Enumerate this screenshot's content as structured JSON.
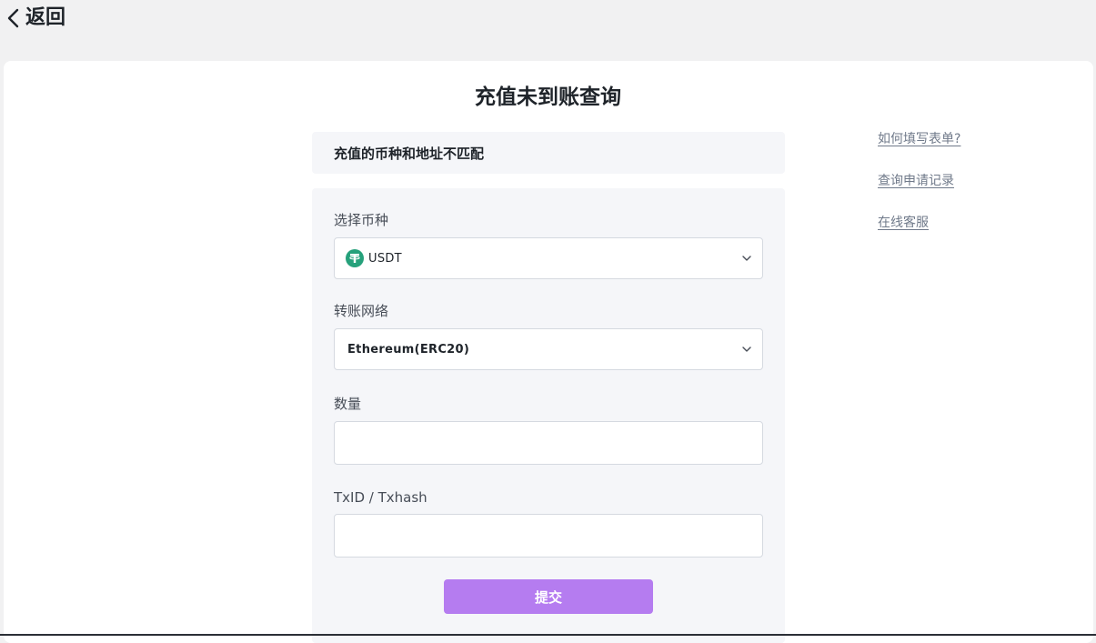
{
  "header": {
    "back_label": "返回"
  },
  "main": {
    "title": "充值未到账查询",
    "notice": "充值的币种和地址不匹配"
  },
  "form": {
    "coin": {
      "label": "选择币种",
      "value": "USDT",
      "icon": "tether-coin-icon",
      "icon_color": "#26A17B"
    },
    "network": {
      "label": "转账网络",
      "value": "Ethereum(ERC20)"
    },
    "amount": {
      "label": "数量",
      "value": "",
      "placeholder": ""
    },
    "txid": {
      "label": "TxID / Txhash",
      "value": "",
      "placeholder": ""
    },
    "submit_label": "提交",
    "submit_color": "#B57CF0"
  },
  "sidebar": {
    "links": [
      {
        "label": "如何填写表单?"
      },
      {
        "label": "查询申请记录"
      },
      {
        "label": "在线客服"
      }
    ]
  }
}
